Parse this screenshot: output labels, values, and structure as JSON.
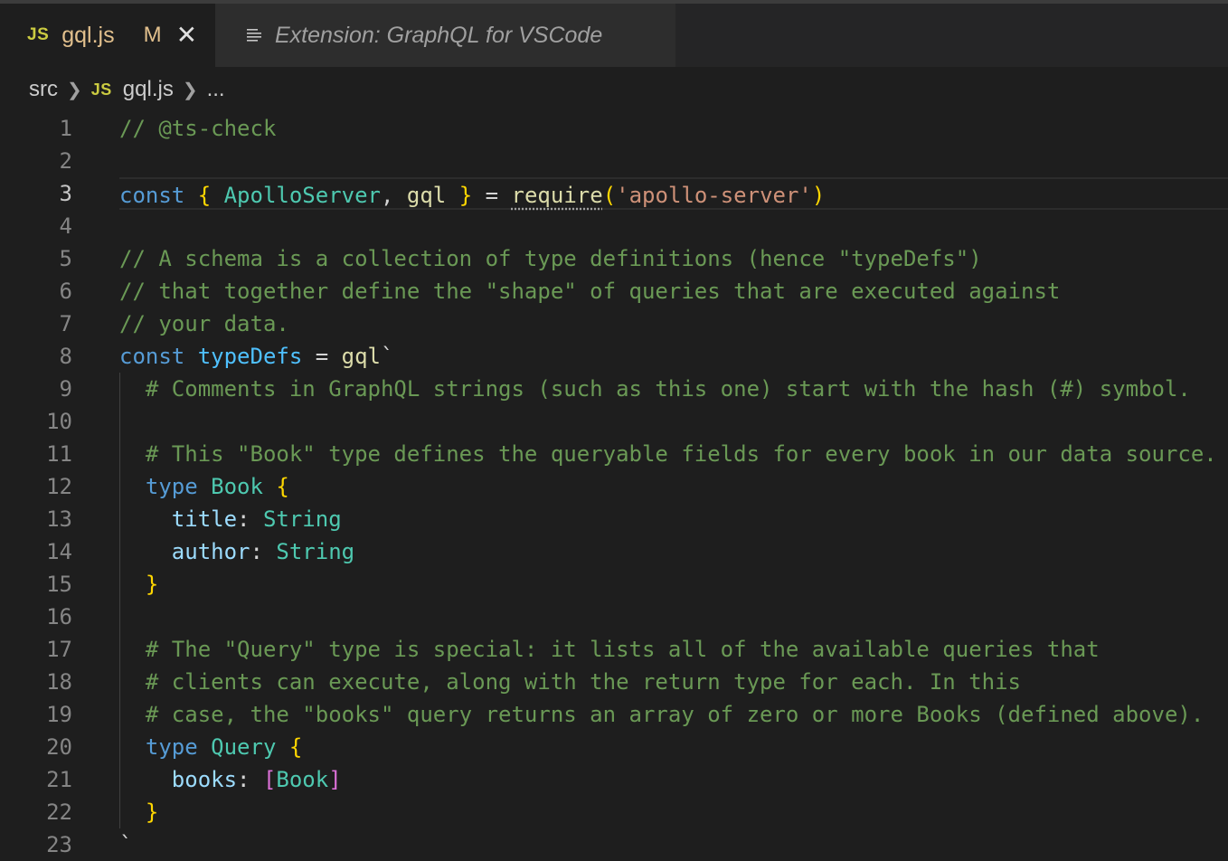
{
  "tabs": [
    {
      "badge": "JS",
      "name": "gql.js",
      "modified": "M",
      "close": "✕"
    },
    {
      "name": "Extension: GraphQL for VSCode"
    }
  ],
  "breadcrumb": {
    "folder": "src",
    "badge": "JS",
    "file": "gql.js",
    "more": "..."
  },
  "editor": {
    "current_line": 3,
    "lines": [
      {
        "n": "1",
        "tokens": [
          {
            "t": "// @ts-check",
            "c": "cm"
          }
        ]
      },
      {
        "n": "2",
        "tokens": []
      },
      {
        "n": "3",
        "tokens": [
          {
            "t": "const",
            "c": "kw"
          },
          {
            "t": " ",
            "c": "pl"
          },
          {
            "t": "{",
            "c": "br"
          },
          {
            "t": " ",
            "c": "pl"
          },
          {
            "t": "ApolloServer",
            "c": "type"
          },
          {
            "t": ", ",
            "c": "pl"
          },
          {
            "t": "gql",
            "c": "fn"
          },
          {
            "t": " ",
            "c": "pl"
          },
          {
            "t": "}",
            "c": "br"
          },
          {
            "t": " = ",
            "c": "pl"
          },
          {
            "t": "require",
            "c": "fn",
            "u": true
          },
          {
            "t": "(",
            "c": "br"
          },
          {
            "t": "'apollo-server'",
            "c": "str"
          },
          {
            "t": ")",
            "c": "br"
          }
        ]
      },
      {
        "n": "4",
        "tokens": []
      },
      {
        "n": "5",
        "tokens": [
          {
            "t": "// A schema is a collection of type definitions (hence \"typeDefs\")",
            "c": "cm"
          }
        ]
      },
      {
        "n": "6",
        "tokens": [
          {
            "t": "// that together define the \"shape\" of queries that are executed against",
            "c": "cm"
          }
        ]
      },
      {
        "n": "7",
        "tokens": [
          {
            "t": "// your data.",
            "c": "cm"
          }
        ]
      },
      {
        "n": "8",
        "tokens": [
          {
            "t": "const",
            "c": "kw"
          },
          {
            "t": " ",
            "c": "pl"
          },
          {
            "t": "typeDefs",
            "c": "var"
          },
          {
            "t": " = ",
            "c": "pl"
          },
          {
            "t": "gql",
            "c": "fn"
          },
          {
            "t": "`",
            "c": "pl"
          }
        ]
      },
      {
        "n": "9",
        "g": true,
        "tokens": [
          {
            "t": "  # Comments in GraphQL strings (such as this one) start with the hash (#) symbol.",
            "c": "cm"
          }
        ]
      },
      {
        "n": "10",
        "g": true,
        "tokens": []
      },
      {
        "n": "11",
        "g": true,
        "tokens": [
          {
            "t": "  # This \"Book\" type defines the queryable fields for every book in our data source.",
            "c": "cm"
          }
        ]
      },
      {
        "n": "12",
        "g": true,
        "tokens": [
          {
            "t": "  ",
            "c": "pl"
          },
          {
            "t": "type",
            "c": "kw"
          },
          {
            "t": " ",
            "c": "pl"
          },
          {
            "t": "Book",
            "c": "type"
          },
          {
            "t": " ",
            "c": "pl"
          },
          {
            "t": "{",
            "c": "br"
          }
        ]
      },
      {
        "n": "13",
        "g": true,
        "tokens": [
          {
            "t": "    ",
            "c": "pl"
          },
          {
            "t": "title",
            "c": "prop"
          },
          {
            "t": ": ",
            "c": "pl"
          },
          {
            "t": "String",
            "c": "type"
          }
        ]
      },
      {
        "n": "14",
        "g": true,
        "tokens": [
          {
            "t": "    ",
            "c": "pl"
          },
          {
            "t": "author",
            "c": "prop"
          },
          {
            "t": ": ",
            "c": "pl"
          },
          {
            "t": "String",
            "c": "type"
          }
        ]
      },
      {
        "n": "15",
        "g": true,
        "tokens": [
          {
            "t": "  ",
            "c": "pl"
          },
          {
            "t": "}",
            "c": "br"
          }
        ]
      },
      {
        "n": "16",
        "g": true,
        "tokens": []
      },
      {
        "n": "17",
        "g": true,
        "tokens": [
          {
            "t": "  # The \"Query\" type is special: it lists all of the available queries that",
            "c": "cm"
          }
        ]
      },
      {
        "n": "18",
        "g": true,
        "tokens": [
          {
            "t": "  # clients can execute, along with the return type for each. In this",
            "c": "cm"
          }
        ]
      },
      {
        "n": "19",
        "g": true,
        "tokens": [
          {
            "t": "  # case, the \"books\" query returns an array of zero or more Books (defined above).",
            "c": "cm"
          }
        ]
      },
      {
        "n": "20",
        "g": true,
        "tokens": [
          {
            "t": "  ",
            "c": "pl"
          },
          {
            "t": "type",
            "c": "kw"
          },
          {
            "t": " ",
            "c": "pl"
          },
          {
            "t": "Query",
            "c": "type"
          },
          {
            "t": " ",
            "c": "pl"
          },
          {
            "t": "{",
            "c": "br"
          }
        ]
      },
      {
        "n": "21",
        "g": true,
        "tokens": [
          {
            "t": "    ",
            "c": "pl"
          },
          {
            "t": "books",
            "c": "prop"
          },
          {
            "t": ": ",
            "c": "pl"
          },
          {
            "t": "[",
            "c": "br2"
          },
          {
            "t": "Book",
            "c": "type"
          },
          {
            "t": "]",
            "c": "br2"
          }
        ]
      },
      {
        "n": "22",
        "g": true,
        "tokens": [
          {
            "t": "  ",
            "c": "pl"
          },
          {
            "t": "}",
            "c": "br"
          }
        ]
      },
      {
        "n": "23",
        "tokens": [
          {
            "t": "`",
            "c": "pl"
          }
        ]
      }
    ]
  },
  "colors": {
    "editor_bg": "#1e1e1e",
    "tabbar_bg": "#252526",
    "comment": "#6a9955",
    "keyword": "#569cd6",
    "type": "#4ec9b0",
    "function": "#dcdcaa",
    "string": "#ce9178",
    "bracket": "#ffd700",
    "modified": "#e2c08d"
  }
}
